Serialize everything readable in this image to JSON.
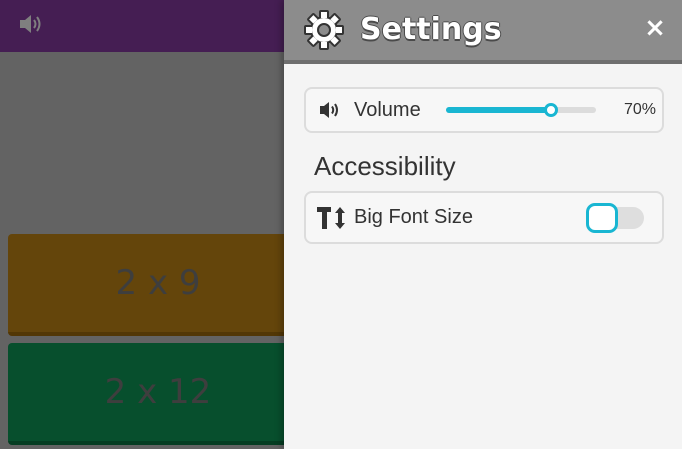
{
  "colors": {
    "game_topbar": "#8a3ca6",
    "panel_header": "#8c8c8c",
    "accent": "#19b6d2",
    "answer_orange": "#c98b16",
    "answer_green": "#0e9e5a"
  },
  "game": {
    "sound_icon": "speaker-icon",
    "answers": [
      {
        "label": "2 x 9"
      },
      {
        "label": "2 x 12"
      }
    ]
  },
  "settings": {
    "title": "Settings",
    "close_label": "×",
    "icon": "gear-icon",
    "volume": {
      "icon": "speaker-icon",
      "label": "Volume",
      "value": 70,
      "value_text": "70%"
    },
    "accessibility": {
      "heading": "Accessibility",
      "big_font": {
        "icon": "text-size-icon",
        "label": "Big Font Size",
        "enabled": false
      }
    }
  }
}
